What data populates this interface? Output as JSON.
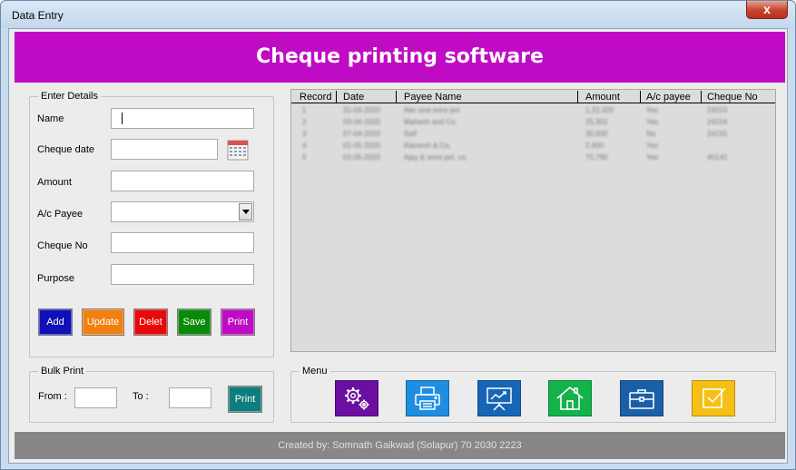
{
  "window": {
    "title": "Data Entry",
    "close_symbol": "x"
  },
  "header": {
    "title": "Cheque printing software"
  },
  "entry": {
    "legend": "Enter Details",
    "name_label": "Name",
    "name_value": "",
    "date_label": "Cheque date",
    "date_value": "",
    "amount_label": "Amount",
    "amount_value": "",
    "payee_label": "A/c Payee",
    "payee_value": "",
    "chequeno_label": "Cheque No",
    "chequeno_value": "",
    "purpose_label": "Purpose",
    "purpose_value": ""
  },
  "buttons": [
    {
      "label": "Add",
      "color": "#1010b8"
    },
    {
      "label": "Update",
      "color": "#f08010"
    },
    {
      "label": "Delet",
      "color": "#e80a0a"
    },
    {
      "label": "Save",
      "color": "#0a8a0a"
    },
    {
      "label": "Print",
      "color": "#c00bc4"
    }
  ],
  "table": {
    "headers": [
      "Record",
      "Date",
      "Payee Name",
      "Amount",
      "A/c payee",
      "Cheque No"
    ],
    "rows": [
      [
        "1",
        "31-03-2020",
        "Abc and sons pvt",
        "1,22,320",
        "Yes",
        "24153"
      ],
      [
        "2",
        "03-04-2020",
        "Mahesh and Co.",
        "25,302",
        "Yes",
        "24154"
      ],
      [
        "3",
        "07-04-2020",
        "Self",
        "30,000",
        "No",
        "24155"
      ],
      [
        "4",
        "01-05-2020",
        "Ramesh & Co.",
        "2,400",
        "Yes",
        ""
      ],
      [
        "5",
        "02-05-2020",
        "Ajay & sons pvt. co.",
        "75,790",
        "Yes",
        "40142"
      ]
    ]
  },
  "bulk": {
    "legend": "Bulk Print",
    "from_label": "From :",
    "to_label": "To :",
    "print_label": "Print",
    "print_color": "#0e7d7d"
  },
  "menu": {
    "legend": "Menu",
    "tiles": [
      {
        "icon": "settings-gears-icon",
        "color": "#6a0fa0"
      },
      {
        "icon": "printer-icon",
        "color": "#1f8ee0"
      },
      {
        "icon": "presentation-chart-icon",
        "color": "#1765b6"
      },
      {
        "icon": "home-icon",
        "color": "#13b24b"
      },
      {
        "icon": "briefcase-icon",
        "color": "#1a5fa8"
      },
      {
        "icon": "checklist-icon",
        "color": "#f5c013"
      }
    ]
  },
  "footer": {
    "text": "Created by: Somnath Gaikwad (Solapur) 70 2030 2223"
  }
}
